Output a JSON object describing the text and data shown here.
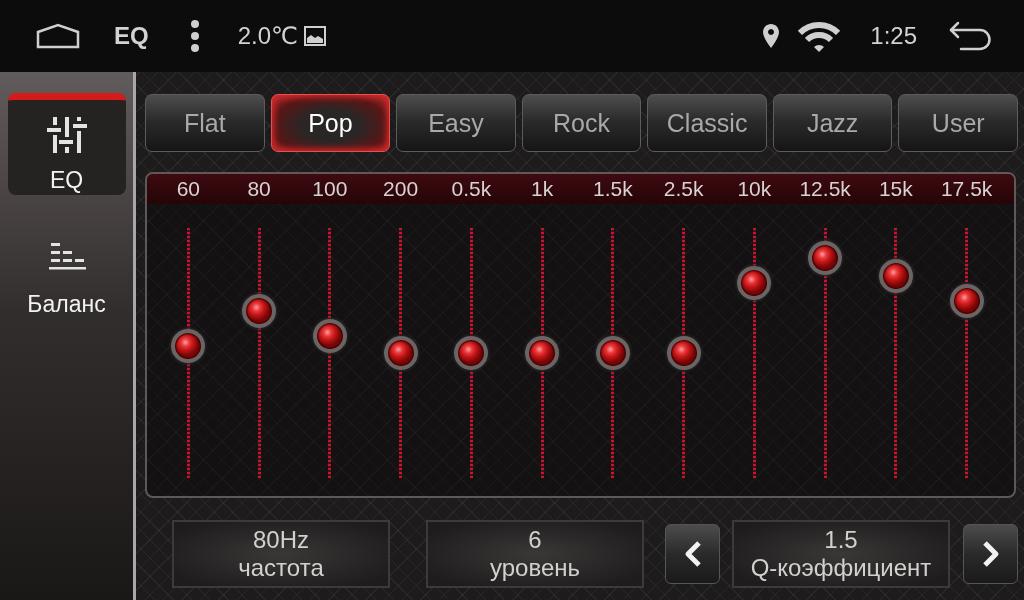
{
  "status_bar": {
    "title": "EQ",
    "temperature": "2.0℃",
    "time": "1:25"
  },
  "sidebar": {
    "items": [
      {
        "label": "EQ",
        "selected": true
      },
      {
        "label": "Баланс",
        "selected": false
      }
    ]
  },
  "presets": [
    {
      "label": "Flat",
      "selected": false
    },
    {
      "label": "Pop",
      "selected": true
    },
    {
      "label": "Easy",
      "selected": false
    },
    {
      "label": "Rock",
      "selected": false
    },
    {
      "label": "Classic",
      "selected": false
    },
    {
      "label": "Jazz",
      "selected": false
    },
    {
      "label": "User",
      "selected": false
    }
  ],
  "equalizer": {
    "bands": [
      {
        "label": "60",
        "level": 0.53
      },
      {
        "label": "80",
        "level": 0.67
      },
      {
        "label": "100",
        "level": 0.57
      },
      {
        "label": "200",
        "level": 0.5
      },
      {
        "label": "0.5k",
        "level": 0.5
      },
      {
        "label": "1k",
        "level": 0.5
      },
      {
        "label": "1.5k",
        "level": 0.5
      },
      {
        "label": "2.5k",
        "level": 0.5
      },
      {
        "label": "10k",
        "level": 0.78
      },
      {
        "label": "12.5k",
        "level": 0.88
      },
      {
        "label": "15k",
        "level": 0.81
      },
      {
        "label": "17.5k",
        "level": 0.71
      }
    ]
  },
  "readouts": [
    {
      "kind": "display",
      "value": "80Hz",
      "label": "частота"
    },
    {
      "kind": "display",
      "value": "6",
      "label": "уровень"
    },
    {
      "kind": "stepper",
      "value": "1.5",
      "label": "Q-коэффициент"
    }
  ]
}
